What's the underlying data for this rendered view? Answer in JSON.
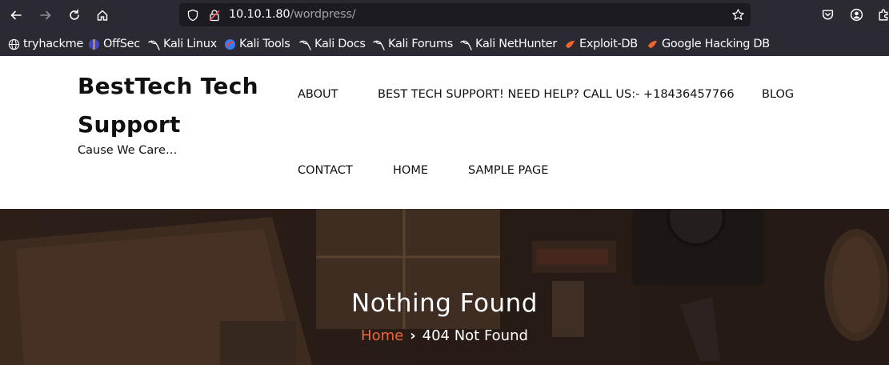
{
  "browser": {
    "url_host": "10.10.1.80",
    "url_path": "/wordpress/",
    "bookmarks": [
      {
        "label": "tryhackme",
        "icon": "globe-icon"
      },
      {
        "label": "OffSec",
        "icon": "offsec-icon"
      },
      {
        "label": "Kali Linux",
        "icon": "kali-dragon-icon"
      },
      {
        "label": "Kali Tools",
        "icon": "kali-tools-icon"
      },
      {
        "label": "Kali Docs",
        "icon": "kali-dragon-icon"
      },
      {
        "label": "Kali Forums",
        "icon": "kali-dragon-icon"
      },
      {
        "label": "Kali NetHunter",
        "icon": "kali-dragon-icon"
      },
      {
        "label": "Exploit-DB",
        "icon": "exploit-db-icon"
      },
      {
        "label": "Google Hacking DB",
        "icon": "exploit-db-icon"
      }
    ]
  },
  "site": {
    "title": "BestTech Tech Support",
    "tagline": "Cause We Care…",
    "menu": {
      "about": "ABOUT",
      "support": "BEST TECH SUPPORT! NEED HELP? CALL US:- +18436457766",
      "blog": "BLOG",
      "contact": "CONTACT",
      "home": "HOME",
      "sample": "SAMPLE PAGE"
    }
  },
  "hero": {
    "title": "Nothing Found",
    "breadcrumb_home": "Home",
    "breadcrumb_current": "404 Not Found"
  },
  "colors": {
    "accent": "#f0663a",
    "chrome_bg": "#2b2a33",
    "urlbar_bg": "#1c1b22"
  }
}
